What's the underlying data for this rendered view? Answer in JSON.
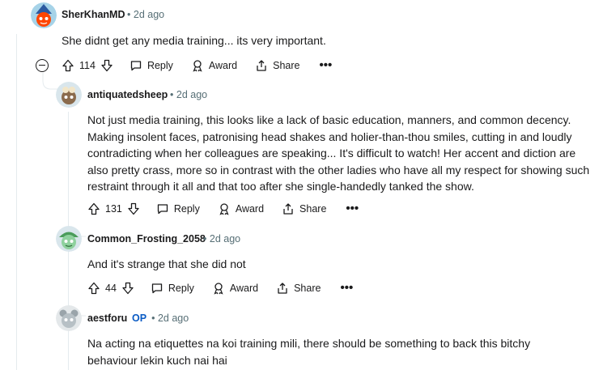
{
  "comments": [
    {
      "author": "SherKhanMD",
      "time": "2d ago",
      "text": "She didnt get any media training... its very important.",
      "votes": "114"
    },
    {
      "author": "antiquatedsheep",
      "time": "2d ago",
      "text_lines": [
        "Not just media training, this looks like a lack of basic education, manners, and common decency.",
        "Making insolent faces, patronising head shakes and holier-than-thou smiles, cutting in and loudly",
        "contradicting when her colleagues are speaking... It's difficult to watch! Her accent and diction are",
        "also pretty crass, more so in contrast with the other ladies who have all my respect for showing such",
        "restraint through it all and that too after she single-handedly tanked the show."
      ],
      "votes": "131"
    },
    {
      "author": "Common_Frosting_2058",
      "time": "2d ago",
      "text": "And it's strange that she did not",
      "votes": "44"
    },
    {
      "author": "aestforu",
      "op_badge": "OP",
      "time": "2d ago",
      "text_lines": [
        "Na acting na etiquettes na koi training mili, there should be something to back this bitchy",
        "behaviour lekin kuch nai hai"
      ]
    }
  ],
  "actions": {
    "reply": "Reply",
    "award": "Award",
    "share": "Share",
    "more": "•••"
  },
  "separator": "•",
  "colors": {
    "text": "#1a1a1b",
    "meta": "#576f76",
    "op": "#0a5bc4",
    "thread_line": "#e5ebee"
  }
}
